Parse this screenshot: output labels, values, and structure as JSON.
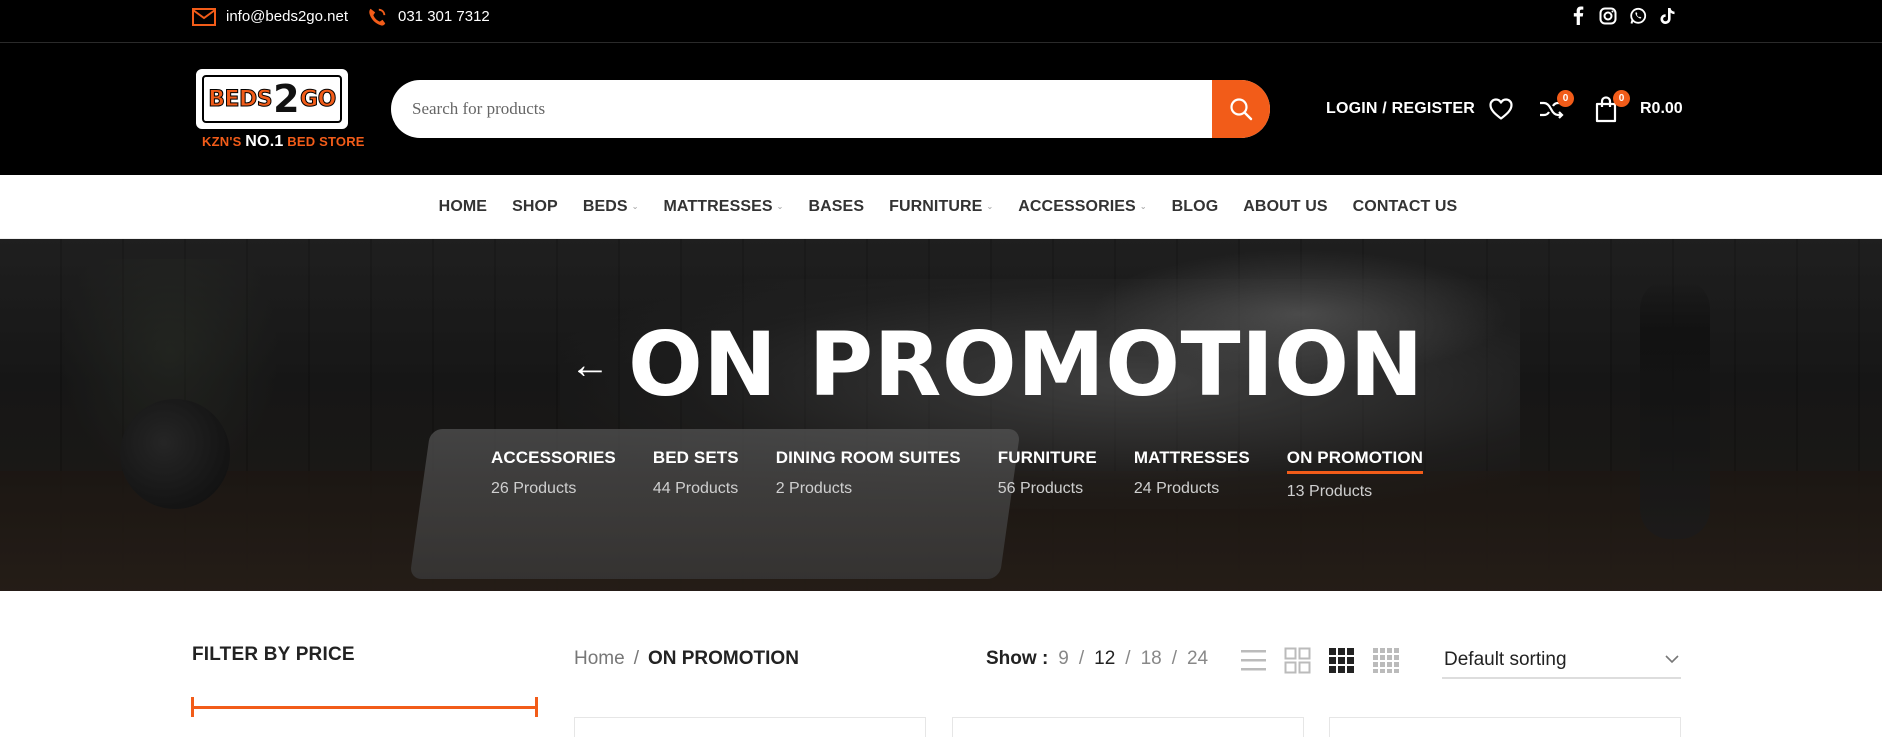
{
  "topbar": {
    "email": "info@beds2go.net",
    "phone": "031 301 7312",
    "socials": [
      "facebook-icon",
      "instagram-icon",
      "whatsapp-icon",
      "tiktok-icon"
    ]
  },
  "header": {
    "logo": {
      "word_left": "BEDS",
      "word_mid": "2",
      "word_right": "GO",
      "tag_left": "KZN'S",
      "tag_mid": "NO.1",
      "tag_right": "BED STORE"
    },
    "search_placeholder": "Search for products",
    "login_label": "LOGIN / REGISTER",
    "compare_count": "0",
    "cart_count": "0",
    "cart_total": "R0.00"
  },
  "nav": {
    "items": [
      {
        "label": "HOME",
        "dropdown": false
      },
      {
        "label": "SHOP",
        "dropdown": false
      },
      {
        "label": "BEDS",
        "dropdown": true
      },
      {
        "label": "MATTRESSES",
        "dropdown": true
      },
      {
        "label": "BASES",
        "dropdown": false
      },
      {
        "label": "FURNITURE",
        "dropdown": true
      },
      {
        "label": "ACCESSORIES",
        "dropdown": true
      },
      {
        "label": "BLOG",
        "dropdown": false
      },
      {
        "label": "ABOUT US",
        "dropdown": false
      },
      {
        "label": "CONTACT US",
        "dropdown": false
      }
    ]
  },
  "hero": {
    "title": "ON PROMOTION",
    "categories": [
      {
        "name": "ACCESSORIES",
        "count": "26 Products",
        "active": false
      },
      {
        "name": "BED SETS",
        "count": "44 Products",
        "active": false
      },
      {
        "name": "DINING ROOM SUITES",
        "count": "2 Products",
        "active": false
      },
      {
        "name": "FURNITURE",
        "count": "56 Products",
        "active": false
      },
      {
        "name": "MATTRESSES",
        "count": "24 Products",
        "active": false
      },
      {
        "name": "ON PROMOTION",
        "count": "13 Products",
        "active": true
      }
    ]
  },
  "sidebar": {
    "filter_title": "FILTER BY PRICE"
  },
  "toolbar": {
    "breadcrumb_home": "Home",
    "breadcrumb_sep": "/",
    "breadcrumb_current": "ON PROMOTION",
    "show_label": "Show :",
    "show_options": [
      "9",
      "12",
      "18",
      "24"
    ],
    "show_selected": "12",
    "sort_value": "Default sorting"
  },
  "colors": {
    "accent": "#f25c19",
    "dark": "#000000"
  }
}
